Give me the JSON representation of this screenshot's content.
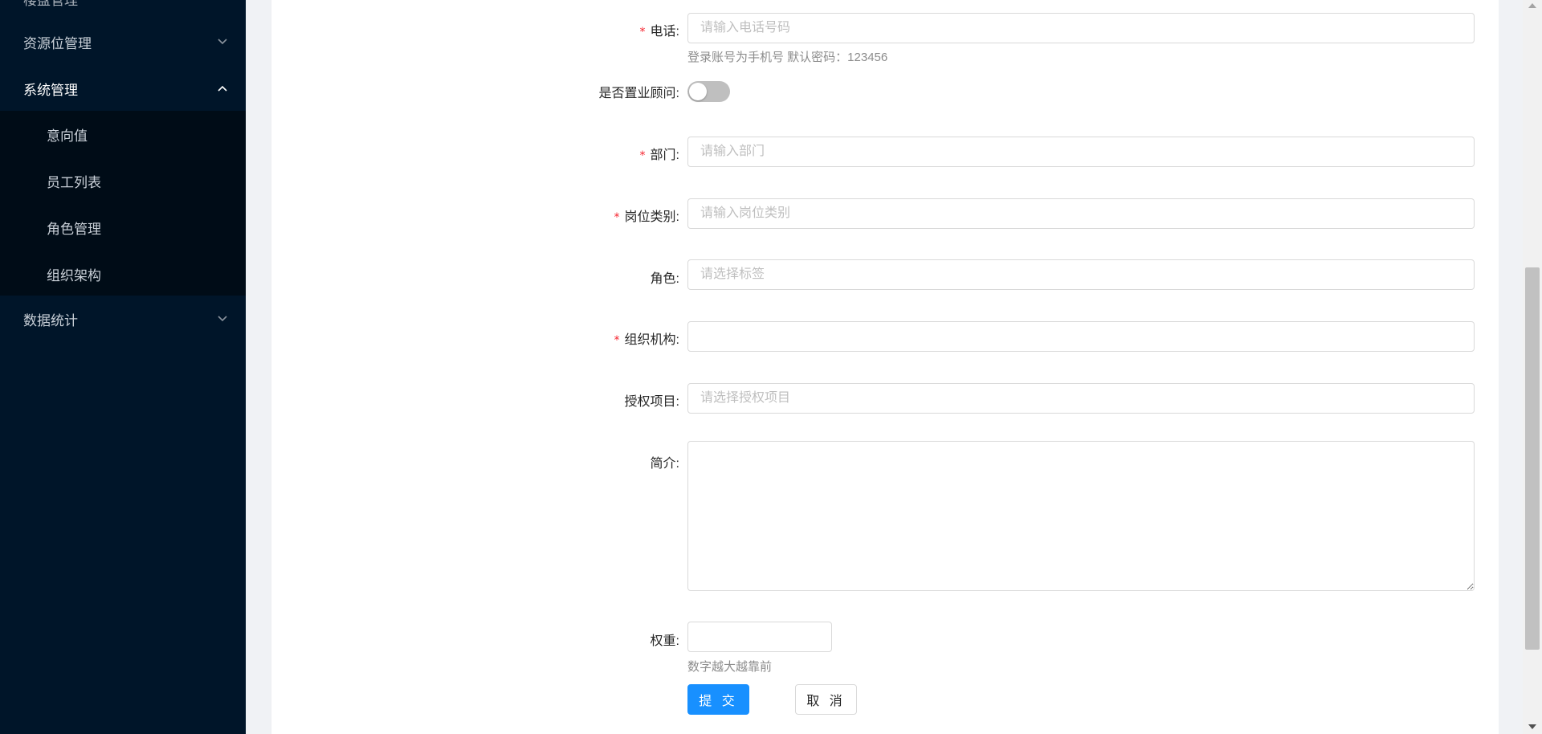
{
  "sidebar": {
    "partial_top_label": "楼盘管理",
    "menu": [
      {
        "label": "资源位管理",
        "expanded": false
      },
      {
        "label": "系统管理",
        "expanded": true
      },
      {
        "label": "数据统计",
        "expanded": false
      }
    ],
    "submenu": [
      {
        "label": "意向值"
      },
      {
        "label": "员工列表"
      },
      {
        "label": "角色管理"
      },
      {
        "label": "组织架构"
      }
    ]
  },
  "form": {
    "phone": {
      "label": "电话:",
      "required": true,
      "placeholder": "请输入电话号码",
      "help": "登录账号为手机号 默认密码：123456"
    },
    "consultant": {
      "label": "是否置业顾问:",
      "value": false
    },
    "department": {
      "label": "部门:",
      "required": true,
      "placeholder": "请输入部门"
    },
    "position": {
      "label": "岗位类别:",
      "required": true,
      "placeholder": "请输入岗位类别"
    },
    "role": {
      "label": "角色:",
      "placeholder": "请选择标签"
    },
    "org": {
      "label": "组织机构:",
      "required": true,
      "placeholder": ""
    },
    "projects": {
      "label": "授权项目:",
      "placeholder": "请选择授权项目"
    },
    "intro": {
      "label": "简介:",
      "value": ""
    },
    "weight": {
      "label": "权重:",
      "value": "",
      "help": "数字越大越靠前"
    },
    "submit_label": "提 交",
    "cancel_label": "取 消"
  },
  "colors": {
    "sidebar_bg": "#001529",
    "submenu_bg": "#000c17",
    "primary": "#1890ff",
    "required": "#f5222d"
  }
}
